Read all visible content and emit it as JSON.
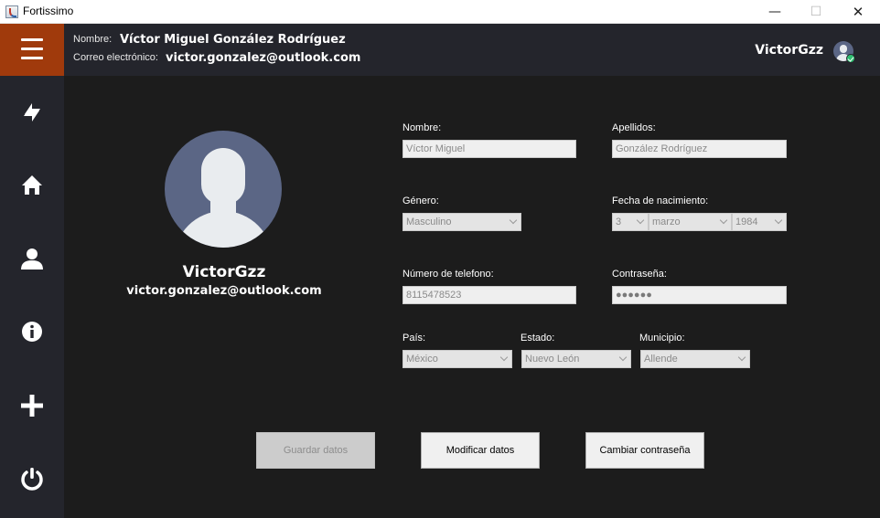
{
  "window": {
    "title": "Fortissimo",
    "minimize": "—",
    "maximize": "☐",
    "close": "✕"
  },
  "header": {
    "name_label": "Nombre:",
    "name_value": "Víctor Miguel  González Rodríguez",
    "email_label": "Correo electrónico:",
    "email_value": "victor.gonzalez@outlook.com",
    "username": "VictorGzz"
  },
  "sidebar": {
    "items": [
      {
        "icon": "sync-icon"
      },
      {
        "icon": "home-icon"
      },
      {
        "icon": "user-icon"
      },
      {
        "icon": "info-icon"
      },
      {
        "icon": "plus-icon"
      },
      {
        "icon": "power-icon"
      }
    ]
  },
  "profile": {
    "username": "VictorGzz",
    "email": "victor.gonzalez@outlook.com"
  },
  "form": {
    "nombre_label": "Nombre:",
    "nombre_value": "Víctor Miguel",
    "apellidos_label": "Apellidos:",
    "apellidos_value": "González Rodríguez",
    "genero_label": "Género:",
    "genero_value": "Masculino",
    "fecha_label": "Fecha de nacimiento:",
    "fecha_dia": "3",
    "fecha_mes": "marzo",
    "fecha_anio": "1984",
    "telefono_label": "Número de telefono:",
    "telefono_value": "8115478523",
    "contrasena_label": "Contraseña:",
    "contrasena_value": "●●●●●●",
    "pais_label": "País:",
    "pais_value": "México",
    "estado_label": "Estado:",
    "estado_value": "Nuevo León",
    "municipio_label": "Municipio:",
    "municipio_value": "Allende"
  },
  "buttons": {
    "guardar": "Guardar datos",
    "modificar": "Modificar datos",
    "cambiar": "Cambiar contraseña"
  },
  "colors": {
    "header_bg": "#24252c",
    "menu_accent": "#a03a0c",
    "main_bg": "#1c1c1c",
    "avatar_bg": "#5b6685",
    "status_online": "#2fbf71"
  }
}
